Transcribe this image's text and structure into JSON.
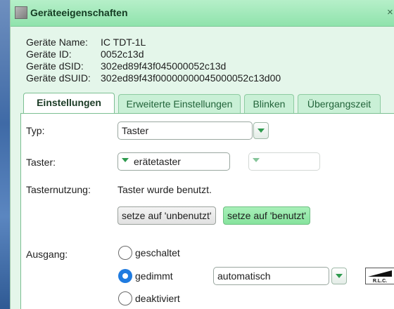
{
  "window": {
    "title": "Geräteeigenschaften",
    "close_glyph": "×"
  },
  "info": [
    {
      "key": "Geräte Name:",
      "value": "IC TDT-1L"
    },
    {
      "key": "Geräte ID:",
      "value": "0052c13d"
    },
    {
      "key": "Geräte dSID:",
      "value": "302ed89f43f045000052c13d"
    },
    {
      "key": "Geräte dSUID:",
      "value": "302ed89f43f00000000045000052c13d00"
    }
  ],
  "tabs": [
    {
      "label": "Einstellungen",
      "active": true
    },
    {
      "label": "Erweiterte Einstellungen",
      "active": false
    },
    {
      "label": "Blinken",
      "active": false
    },
    {
      "label": "Übergangszeit",
      "active": false
    }
  ],
  "form": {
    "typ": {
      "label": "Typ:",
      "value": "Taster"
    },
    "taster": {
      "label": "Taster:",
      "value": "erätetaster",
      "second_value": ""
    },
    "tasternutzung": {
      "label": "Tasternutzung:",
      "status": "Taster wurde benutzt.",
      "btn_unused": "setze auf 'unbenutzt'",
      "btn_used": "setze auf 'benutzt'"
    },
    "ausgang": {
      "label": "Ausgang:",
      "options": [
        {
          "label": "geschaltet",
          "selected": false
        },
        {
          "label": "gedimmt",
          "selected": true
        },
        {
          "label": "deaktiviert",
          "selected": false
        }
      ],
      "mode_value": "automatisch",
      "rlc_text": "R.L.C."
    }
  },
  "colors": {
    "titlebar": "#8fe3ac",
    "accent_green": "#86e39d",
    "radio_selected": "#1f7be0",
    "dropdown_arrow": "#2e9a4e"
  }
}
